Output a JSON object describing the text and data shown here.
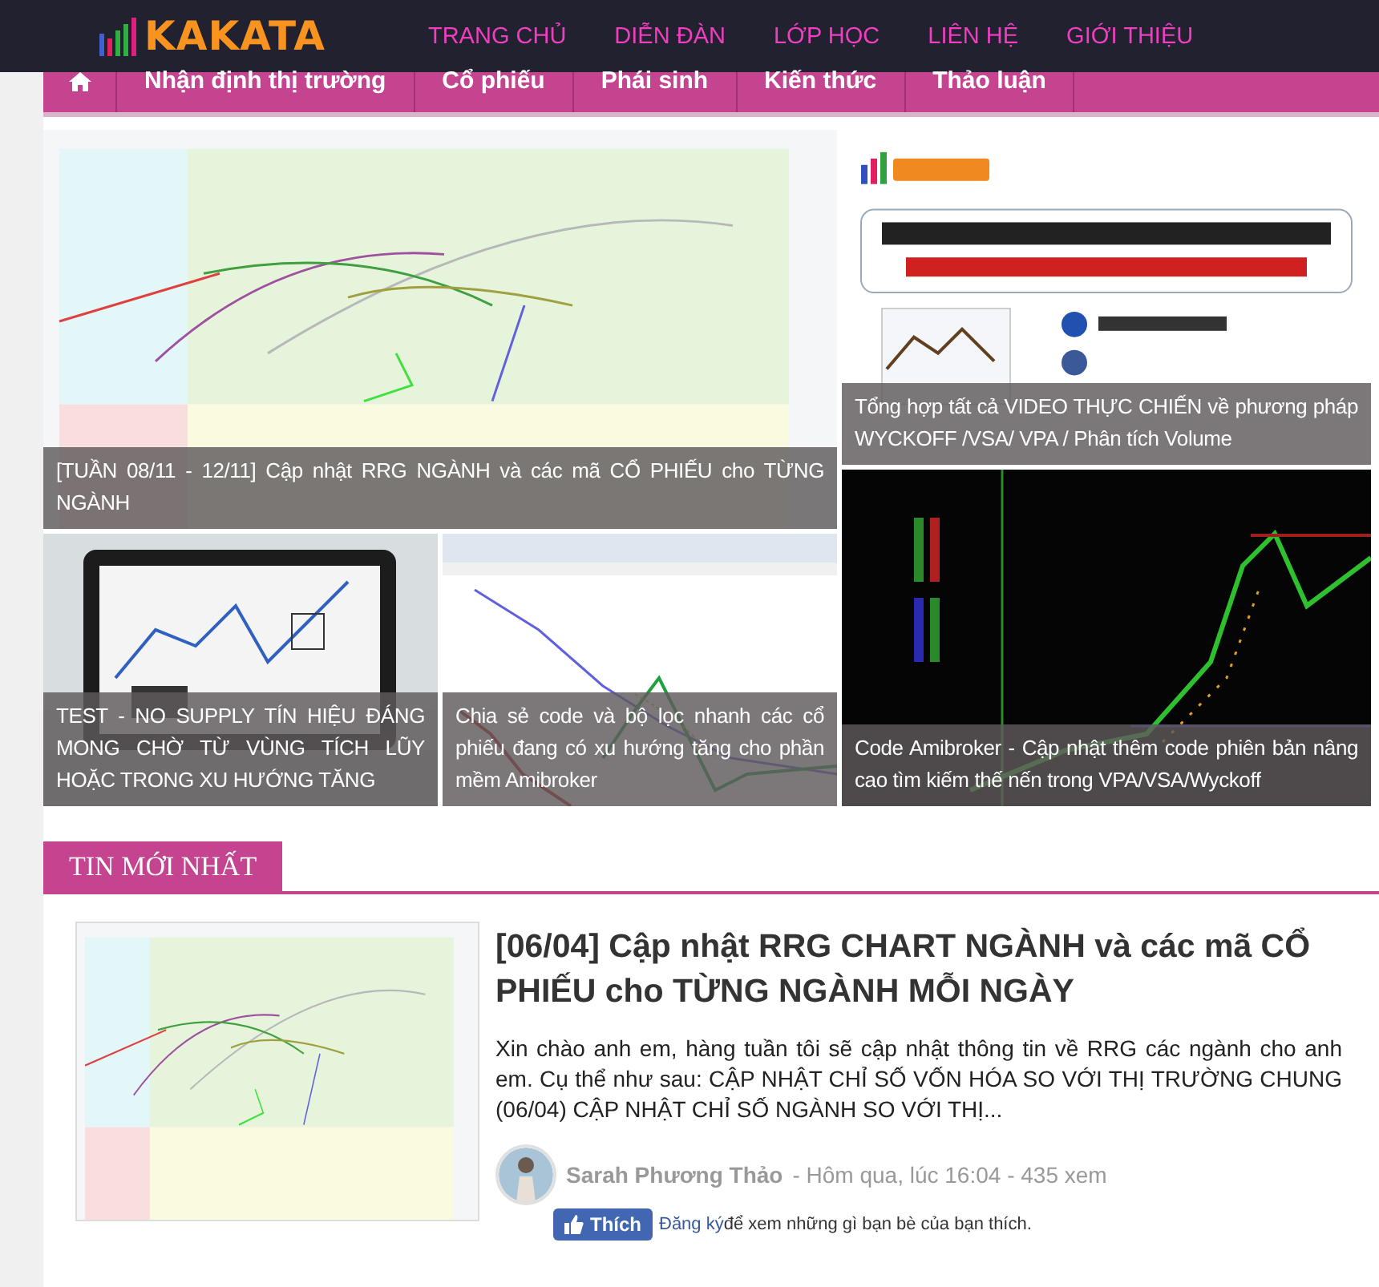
{
  "header": {
    "logo": "KAKATA",
    "nav": [
      {
        "label": "TRANG CHỦ"
      },
      {
        "label": "DIỄN ĐÀN"
      },
      {
        "label": "LỚP HỌC"
      },
      {
        "label": "LIÊN HỆ"
      },
      {
        "label": "GIỚI THIỆU"
      }
    ]
  },
  "menu": {
    "items": [
      {
        "label": "Nhận định thị trường"
      },
      {
        "label": "Cổ phiếu"
      },
      {
        "label": "Phái sinh"
      },
      {
        "label": "Kiến thức"
      },
      {
        "label": "Thảo luận"
      }
    ]
  },
  "featured": [
    {
      "caption": "[TUẦN 08/11 - 12/11] Cập nhật RRG NGÀNH và các mã CỔ PHIẾU cho TỪNG NGÀNH"
    },
    {
      "caption": "Tổng hợp tất cả VIDEO THỰC CHIẾN về phương pháp WYCKOFF /VSA/ VPA / Phân tích Volume"
    },
    {
      "caption": "TEST - NO SUPPLY TÍN HIỆU ĐÁNG MONG CHỜ TỪ VÙNG TÍCH LŨY HOẶC TRONG XU HƯỚNG TĂNG"
    },
    {
      "caption": "Chia sẻ code và bộ lọc nhanh các cổ phiếu đang có xu hướng tăng cho phần mềm Amibroker"
    },
    {
      "caption": "Code Amibroker - Cập nhật thêm code phiên bản nâng cao tìm kiếm thế nến trong VPA/VSA/Wyckoff"
    }
  ],
  "latest": {
    "heading": "TIN MỚI NHẤT",
    "post": {
      "title": "[06/04] Cập nhật RRG CHART NGÀNH và các mã CỔ PHIẾU cho TỪNG NGÀNH MỖI NGÀY",
      "excerpt": "Xin chào anh em, hàng tuần tôi sẽ cập nhật thông tin về RRG các ngành cho anh em. Cụ thể như sau: CẬP NHẬT CHỈ SỐ VỐN HÓA SO VỚI THỊ TRƯỜNG CHUNG (06/04) CẬP NHẬT CHỈ SỐ NGÀNH SO VỚI THỊ...",
      "author": "Sarah Phương Thảo",
      "meta": "- Hôm qua, lúc 16:04 - 435 xem",
      "like": "Thích",
      "signup": "Đăng ký",
      "signup_rest": "để xem những gì bạn bè của bạn thích."
    }
  }
}
